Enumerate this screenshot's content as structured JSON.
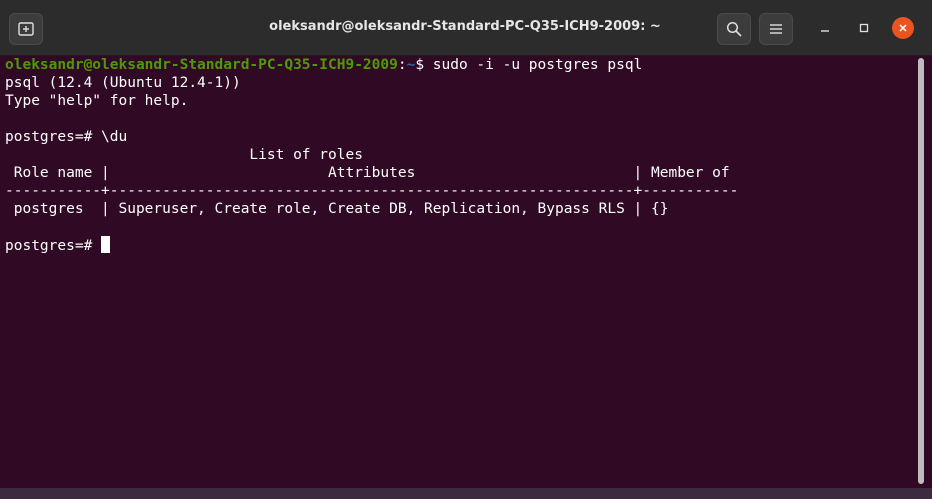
{
  "titlebar": {
    "title": "oleksandr@oleksandr-Standard-PC-Q35-ICH9-2009: ~",
    "icons": {
      "new_tab": "new-tab-icon",
      "search": "search-icon",
      "menu": "hamburger-menu-icon",
      "minimize": "minimize-icon",
      "maximize": "maximize-icon",
      "close": "close-icon"
    }
  },
  "colors": {
    "terminal_bg": "#300a24",
    "prompt_user": "#4e9a06",
    "prompt_path": "#3465a4",
    "close_button": "#e95420",
    "text": "#ffffff"
  },
  "terminal": {
    "prompt_user_host": "oleksandr@oleksandr-Standard-PC-Q35-ICH9-2009",
    "prompt_colon": ":",
    "prompt_path": "~",
    "prompt_symbol": "$ ",
    "command": "sudo -i -u postgres psql",
    "lines": [
      "psql (12.4 (Ubuntu 12.4-1))",
      "Type \"help\" for help.",
      "",
      "postgres=# \\du",
      "                            List of roles",
      " Role name |                         Attributes                         | Member of",
      "-----------+------------------------------------------------------------+-----------",
      " postgres  | Superuser, Create role, Create DB, Replication, Bypass RLS | {}",
      ""
    ],
    "current_prompt": "postgres=# "
  }
}
